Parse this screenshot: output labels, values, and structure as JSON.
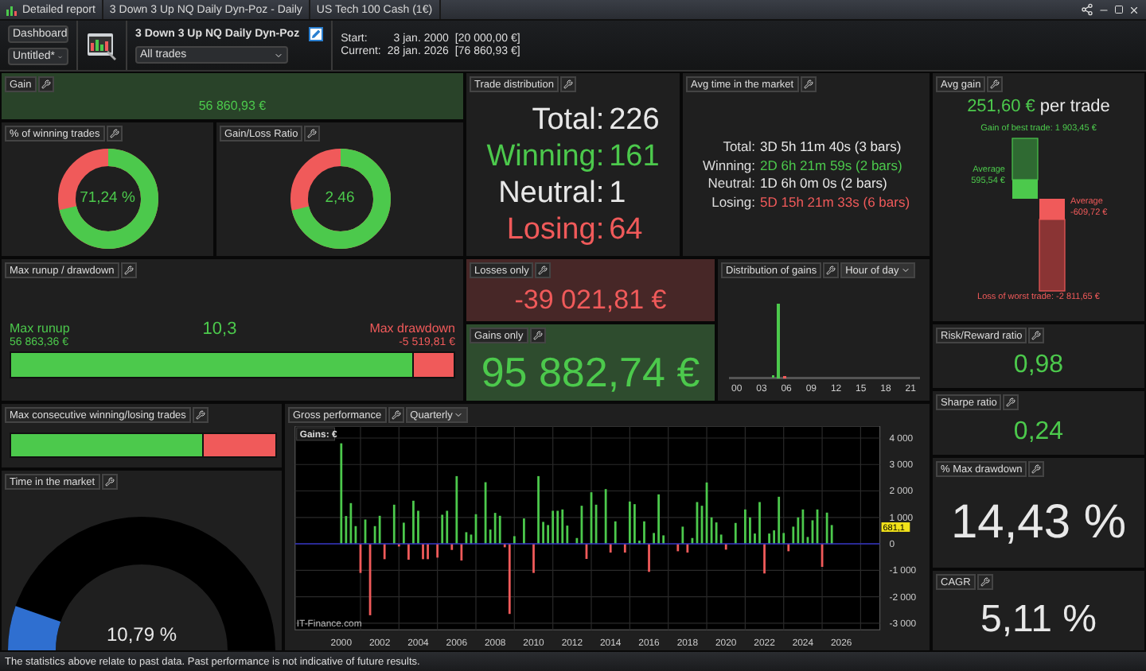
{
  "title_bar": {
    "segments": [
      "Detailed report",
      "3 Down  3 Up NQ Daily Dyn-Poz - Daily",
      "US Tech 100 Cash (1€)"
    ]
  },
  "toolbar": {
    "view_select": "Dashboard",
    "layout_select": "Untitled*",
    "system_name": "3 Down  3 Up NQ Daily Dyn-Poz",
    "trades_select": "All trades",
    "start_label": "Start:",
    "start_date": "3 jan. 2000",
    "start_value": "[20 000,00 €]",
    "current_label": "Current:",
    "current_date": "28 jan. 2026",
    "current_value": "[76 860,93 €]"
  },
  "gain": {
    "title": "Gain",
    "value": "56 860,93 €"
  },
  "winning_trades": {
    "title": "% of winning trades",
    "value": "71,24 %",
    "level": 0.7124
  },
  "gain_loss_ratio": {
    "title": "Gain/Loss Ratio",
    "value": "2,46",
    "level": 0.711
  },
  "trade_distribution": {
    "title": "Trade distribution",
    "rows": [
      {
        "label": "Total:",
        "value": "226",
        "kind": "total"
      },
      {
        "label": "Winning:",
        "value": "161",
        "kind": "winning"
      },
      {
        "label": "Neutral:",
        "value": "1",
        "kind": "neutral"
      },
      {
        "label": "Losing:",
        "value": "64",
        "kind": "losing"
      }
    ]
  },
  "avg_time": {
    "title": "Avg time in the market",
    "rows": [
      {
        "label": "Total:",
        "value": "3D 5h 11m 40s (3 bars)",
        "kind": "total"
      },
      {
        "label": "Winning:",
        "value": "2D 6h 21m 59s (2 bars)",
        "kind": "winning"
      },
      {
        "label": "Neutral:",
        "value": "1D 6h 0m 0s (2 bars)",
        "kind": "neutral"
      },
      {
        "label": "Losing:",
        "value": "5D 15h 21m 33s (6 bars)",
        "kind": "losing"
      }
    ]
  },
  "avg_gain": {
    "title": "Avg gain",
    "value": "251,60 €",
    "suffix": "per trade",
    "best_label": "Gain of best trade: 1 903,45 €",
    "avg_gain_label": "Average",
    "avg_gain_value": "595,54 €",
    "avg_loss_label": "Average",
    "avg_loss_value": "-609,72 €",
    "worst_label": "Loss of worst trade: -2 811,65 €"
  },
  "max_runup": {
    "title": "Max runup / drawdown",
    "runup_label": "Max runup",
    "runup_value": "56 863,36 €",
    "ratio": "10,3",
    "drawdown_label": "Max drawdown",
    "drawdown_value": "-5 519,81 €",
    "level": 0.911
  },
  "losses_only": {
    "title": "Losses only",
    "value": "-39 021,81 €"
  },
  "gains_only": {
    "title": "Gains only",
    "value": "95 882,74 €"
  },
  "distribution": {
    "title": "Distribution of gains",
    "period": "Hour of day",
    "axis_labels": [
      "00",
      "03",
      "06",
      "09",
      "12",
      "15",
      "18",
      "21"
    ]
  },
  "risk_reward": {
    "title": "Risk/Reward ratio",
    "value": "0,98"
  },
  "sharpe": {
    "title": "Sharpe ratio",
    "value": "0,24"
  },
  "max_drawdown_pct": {
    "title": "% Max drawdown",
    "value": "14,43 %"
  },
  "cagr": {
    "title": "CAGR",
    "value": "5,11 %"
  },
  "max_consecutive": {
    "title": "Max consecutive winning/losing trades",
    "level": 0.73
  },
  "time_in_market": {
    "title": "Time in the market",
    "value": "10,79 %",
    "level": 0.1079
  },
  "gross_performance": {
    "title": "Gross performance",
    "period": "Quarterly",
    "credit": "IT-Finance.com",
    "last_value_label": "681,1",
    "chart_data": {
      "type": "bar",
      "ylabel": "Gains: €",
      "grid": true,
      "ref_lines": [
        {
          "axis": "y",
          "value": 0,
          "color": "#3030c0"
        }
      ],
      "xlim": [
        1997.6,
        2028
      ],
      "ylim": [
        -3250,
        4450
      ],
      "x": [
        2000,
        2000.25,
        2000.5,
        2000.75,
        2001,
        2001.25,
        2001.5,
        2001.75,
        2002,
        2002.25,
        2002.5,
        2002.75,
        2003,
        2003.25,
        2003.5,
        2003.75,
        2004,
        2004.25,
        2004.5,
        2004.75,
        2005,
        2005.25,
        2005.5,
        2005.75,
        2006,
        2006.25,
        2006.5,
        2006.75,
        2007,
        2007.25,
        2007.5,
        2007.75,
        2008,
        2008.25,
        2008.5,
        2008.75,
        2009,
        2009.25,
        2009.5,
        2009.75,
        2010,
        2010.25,
        2010.5,
        2010.75,
        2011,
        2011.25,
        2011.5,
        2011.75,
        2012,
        2012.25,
        2012.5,
        2012.75,
        2013,
        2013.25,
        2013.5,
        2013.75,
        2014,
        2014.25,
        2014.5,
        2014.75,
        2015,
        2015.25,
        2015.5,
        2015.75,
        2016,
        2016.25,
        2016.5,
        2016.75,
        2017,
        2017.25,
        2017.5,
        2017.75,
        2018,
        2018.25,
        2018.5,
        2018.75,
        2019,
        2019.25,
        2019.5,
        2019.75,
        2020,
        2020.25,
        2020.5,
        2020.75,
        2021,
        2021.25,
        2021.5,
        2021.75,
        2022,
        2022.25,
        2022.5,
        2022.75,
        2023,
        2023.25,
        2023.5,
        2023.75,
        2024,
        2024.25,
        2024.5,
        2024.75,
        2025,
        2025.25,
        2025.5
      ],
      "series": [
        {
          "values": [
            3800,
            1050,
            1540,
            670,
            -1100,
            920,
            -2700,
            670,
            1060,
            -580,
            null,
            1480,
            -100,
            800,
            -600,
            1630,
            1250,
            -580,
            -580,
            null,
            -520,
            1100,
            1250,
            -230,
            2560,
            -630,
            440,
            350,
            1120,
            null,
            2330,
            540,
            1170,
            1060,
            -130,
            -2650,
            290,
            null,
            960,
            null,
            -1100,
            2560,
            830,
            710,
            1250,
            1250,
            1300,
            690,
            null,
            220,
            1440,
            -570,
            1950,
            1480,
            null,
            2070,
            -330,
            850,
            null,
            -330,
            1600,
            1500,
            120,
            850,
            -1060,
            410,
            1870,
            320,
            null,
            null,
            -280,
            650,
            -330,
            220,
            1580,
            1440,
            2320,
            1000,
            810,
            350,
            -220,
            null,
            790,
            null,
            1300,
            1000,
            390,
            1580,
            -1120,
            390,
            510,
            1780,
            410,
            -280,
            650,
            1000,
            1300,
            260,
            890,
            1300,
            -870,
            1180,
            710
          ]
        }
      ],
      "xticks": [
        2000,
        2002,
        2004,
        2006,
        2008,
        2010,
        2012,
        2014,
        2016,
        2018,
        2020,
        2022,
        2024,
        2026
      ],
      "yticks": [
        {
          "value": 4000,
          "label": "4 000"
        },
        {
          "value": 3000,
          "label": "3 000"
        },
        {
          "value": 2000,
          "label": "2 000"
        },
        {
          "value": 1000,
          "label": "1 000"
        },
        {
          "value": 0,
          "label": "0"
        },
        {
          "value": -1000,
          "label": "-1 000"
        },
        {
          "value": -2000,
          "label": "-2 000"
        },
        {
          "value": -3000,
          "label": "-3 000"
        }
      ]
    }
  },
  "status_bar": "The statistics above relate to past data. Past performance is not indicative of future results."
}
